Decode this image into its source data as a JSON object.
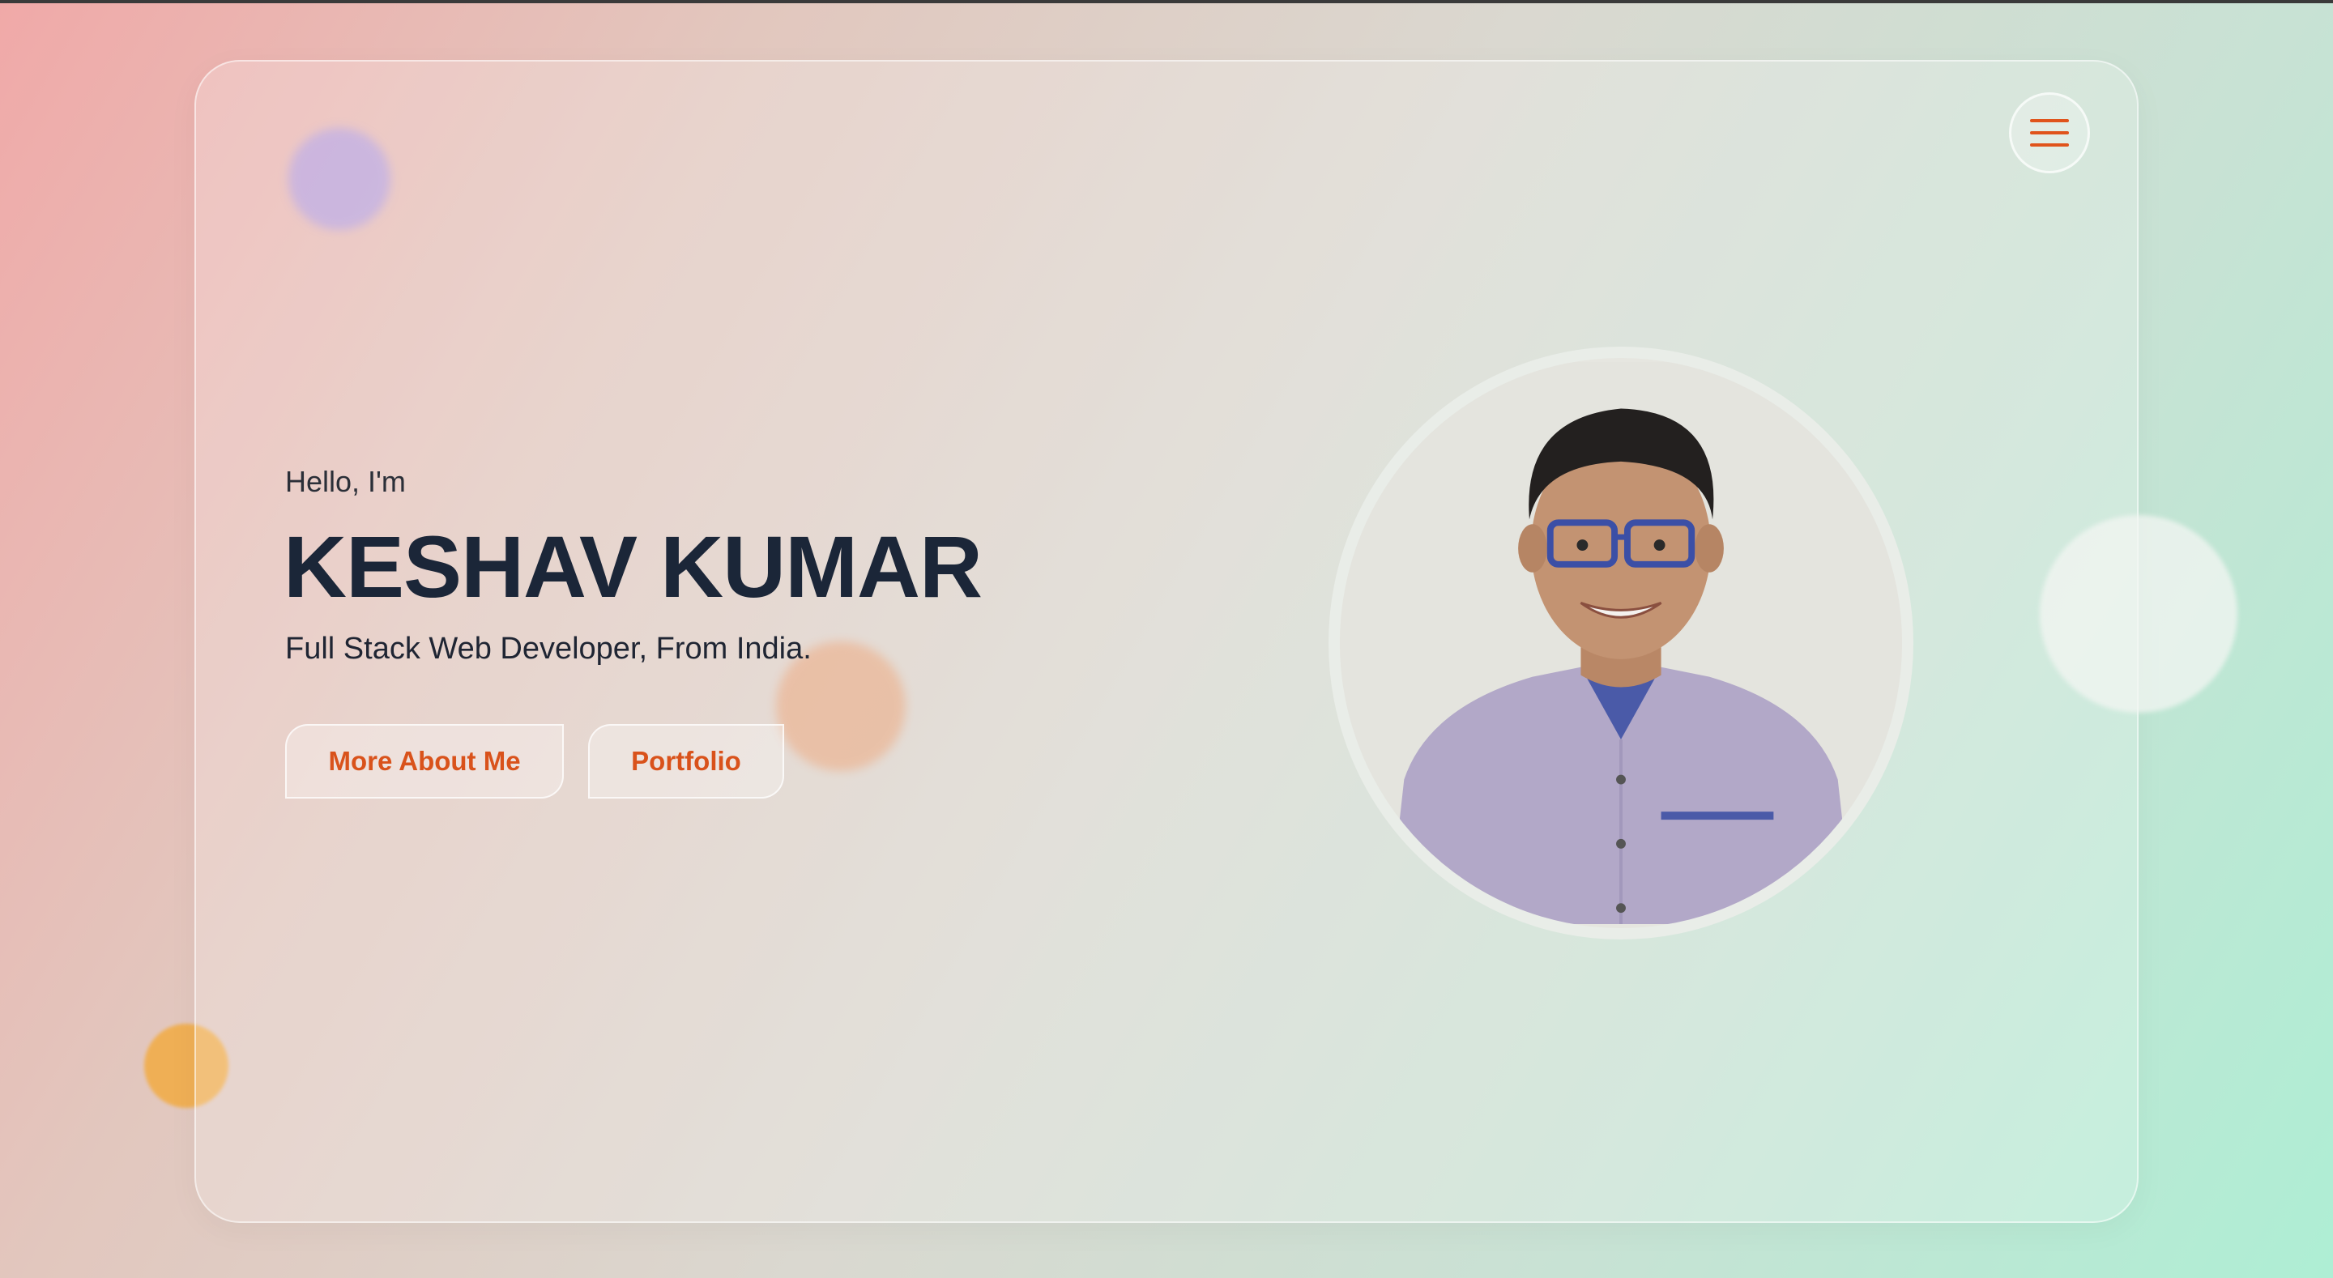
{
  "hero": {
    "greeting": "Hello, I'm",
    "name": "KESHAV KUMAR",
    "tagline": "Full Stack Web Developer, From India."
  },
  "buttons": {
    "more_about": "More About Me",
    "portfolio": "Portfolio"
  },
  "icons": {
    "menu": "hamburger-menu-icon",
    "profile": "profile-photo"
  },
  "colors": {
    "accent": "#e0541c",
    "heading": "#1b2638"
  }
}
